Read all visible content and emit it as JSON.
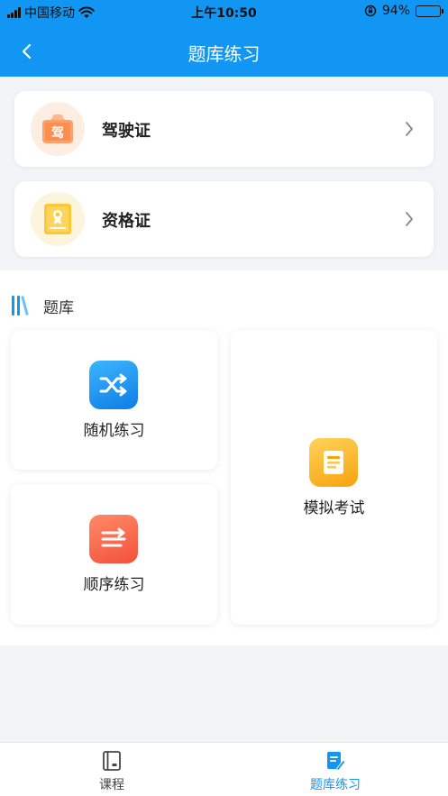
{
  "status_bar": {
    "carrier": "中国移动",
    "time": "上午10:50",
    "battery": "94%"
  },
  "nav": {
    "title": "题库练习",
    "back_icon": "chevron-left-icon"
  },
  "categories": [
    {
      "label": "驾驶证",
      "icon_text": "驾",
      "icon": "driver-license-icon"
    },
    {
      "label": "资格证",
      "icon": "certificate-icon"
    }
  ],
  "bank": {
    "title": "题库",
    "random_label": "随机练习",
    "sequential_label": "顺序练习",
    "mock_label": "模拟考试"
  },
  "tabs": [
    {
      "label": "课程",
      "active": false
    },
    {
      "label": "题库练习",
      "active": true
    }
  ],
  "colors": {
    "accent": "#1296f3",
    "background": "#f3f4f8"
  }
}
